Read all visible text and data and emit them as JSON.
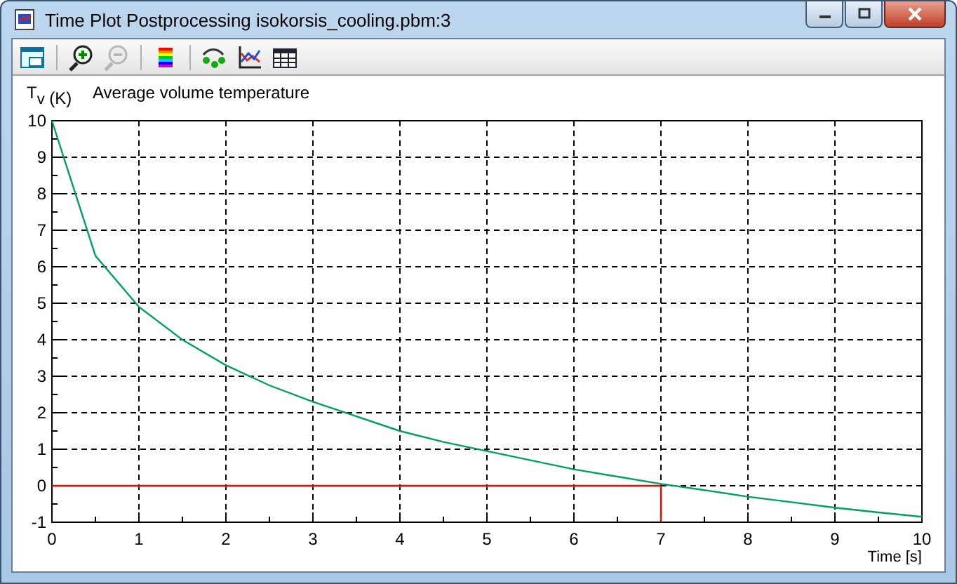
{
  "window": {
    "title": "Time Plot Postprocessing isokorsis_cooling.pbm:3"
  },
  "toolbar": {
    "buttons": [
      {
        "kind": "window",
        "disabled": false
      },
      {
        "kind": "zoom-in",
        "disabled": false
      },
      {
        "kind": "zoom-out",
        "disabled": true
      },
      {
        "kind": "palette",
        "disabled": false
      },
      {
        "kind": "route",
        "disabled": false
      },
      {
        "kind": "plot",
        "disabled": false
      },
      {
        "kind": "table",
        "disabled": false
      }
    ]
  },
  "plot": {
    "chart_data": {
      "type": "line",
      "title": "Average volume temperature",
      "xlabel": "Time [s]",
      "ylabel": "T$_{v}$ (K)",
      "x": [
        0,
        0.5,
        1,
        1.5,
        2,
        2.5,
        3,
        3.5,
        4,
        4.5,
        5,
        5.5,
        6,
        6.5,
        7,
        7.5,
        8,
        8.5,
        9,
        9.5,
        10
      ],
      "series": [
        {
          "color": "#00a060",
          "values": [
            10,
            6.3,
            4.9,
            4.0,
            3.3,
            2.75,
            2.3,
            1.9,
            1.5,
            1.2,
            0.95,
            0.7,
            0.45,
            0.25,
            0.05,
            -0.12,
            -0.3,
            -0.45,
            -0.6,
            -0.73,
            -0.85
          ]
        }
      ],
      "xlim": [
        0,
        10
      ],
      "ylim": [
        -1,
        10
      ],
      "xticks": [
        0,
        1,
        2,
        3,
        4,
        5,
        6,
        7,
        8,
        9,
        10
      ],
      "yticks": [
        -1,
        0,
        1,
        2,
        3,
        4,
        5,
        6,
        7,
        8,
        9,
        10
      ],
      "grid": true,
      "ref_lines": [
        {
          "axis": "y",
          "value": 0,
          "color": "#ff0000"
        },
        {
          "axis": "x",
          "value": 7,
          "color": "#ff0000"
        }
      ]
    }
  }
}
